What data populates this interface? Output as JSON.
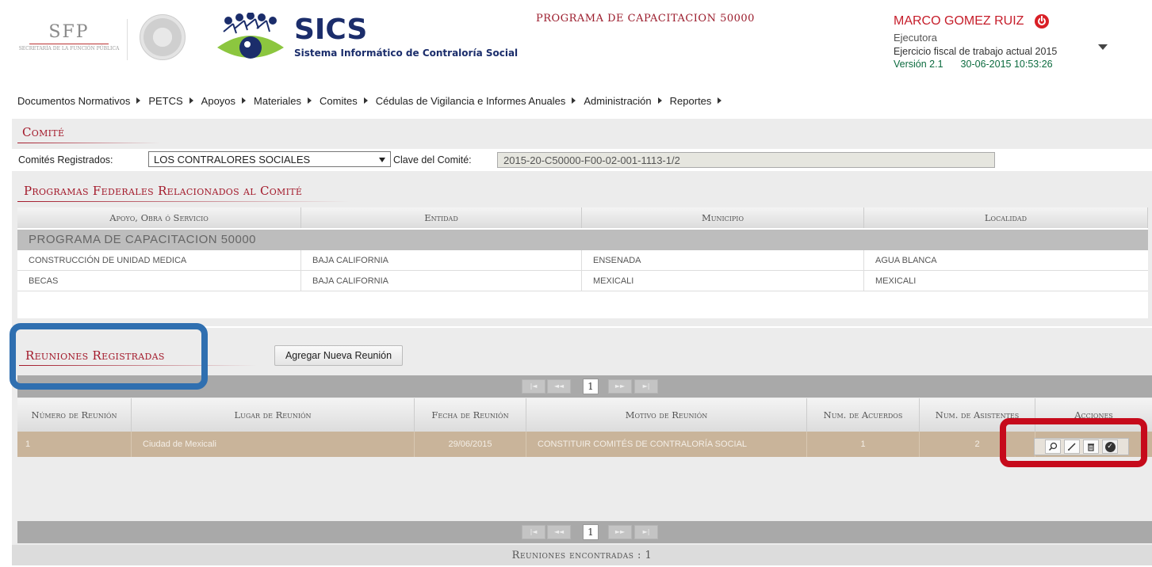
{
  "header": {
    "sfp_logo": "SFP",
    "sfp_subtitle": "SECRETARÍA DE LA FUNCIÓN PÚBLICA",
    "app_name": "SICS",
    "app_subtitle": "Sistema Informático de Contraloría Social",
    "program": "PROGRAMA DE CAPACITACION 50000",
    "user_name": "MARCO GOMEZ RUIZ",
    "user_role": "Ejecutora",
    "fiscal": "Ejercicio fiscal de trabajo actual  2015",
    "version": "Versión 2.1",
    "datetime": "30-06-2015 10:53:26"
  },
  "menu": [
    "Documentos Normativos",
    "PETCS",
    "Apoyos",
    "Materiales",
    "Comites",
    "Cédulas de Vigilancia e Informes Anuales",
    "Administración",
    "Reportes"
  ],
  "comite": {
    "title": "Comité",
    "registrados_label": "Comités Registrados:",
    "registrados_value": "LOS CONTRALORES SOCIALES",
    "clave_label": "Clave del Comité:",
    "clave_value": "2015-20-C50000-F00-02-001-1113-1/2"
  },
  "programas": {
    "title": "Programas Federales Relacionados al Comité",
    "columns": [
      "Apoyo, Obra ó Servicio",
      "Entidad",
      "Municipio",
      "Localidad"
    ],
    "group": "PROGRAMA DE CAPACITACION 50000",
    "rows": [
      [
        "CONSTRUCCIÓN DE UNIDAD MEDICA",
        "BAJA CALIFORNIA",
        "ENSENADA",
        "AGUA BLANCA"
      ],
      [
        "BECAS",
        "BAJA CALIFORNIA",
        "MEXICALI",
        "MEXICALI"
      ]
    ]
  },
  "reuniones": {
    "title": "Reuniones Registradas",
    "add_button": "Agregar Nueva Reunión",
    "page": "1",
    "columns": [
      "Número de Reunión",
      "Lugar de Reunión",
      "Fecha de Reunión",
      "Motivo de Reunión",
      "Num. de Acuerdos",
      "Num. de Asistentes",
      "Acciones"
    ],
    "row": {
      "numero": "1",
      "lugar": "Ciudad de Mexicali",
      "fecha": "29/06/2015",
      "motivo": "CONSTITUIR COMITÉS DE CONTRALORÍA SOCIAL",
      "acuerdos": "1",
      "asistentes": "2"
    },
    "found": "Reuniones encontradas : 1"
  },
  "colors": {
    "brand_red": "#a3192a",
    "highlight_blue": "#2f6fb0",
    "highlight_red": "#c60a1b",
    "row_selected": "#c9b49a"
  },
  "icons": [
    "power-icon",
    "caret-down-icon",
    "search-icon",
    "edit-icon",
    "trash-icon",
    "check-circle-icon"
  ]
}
